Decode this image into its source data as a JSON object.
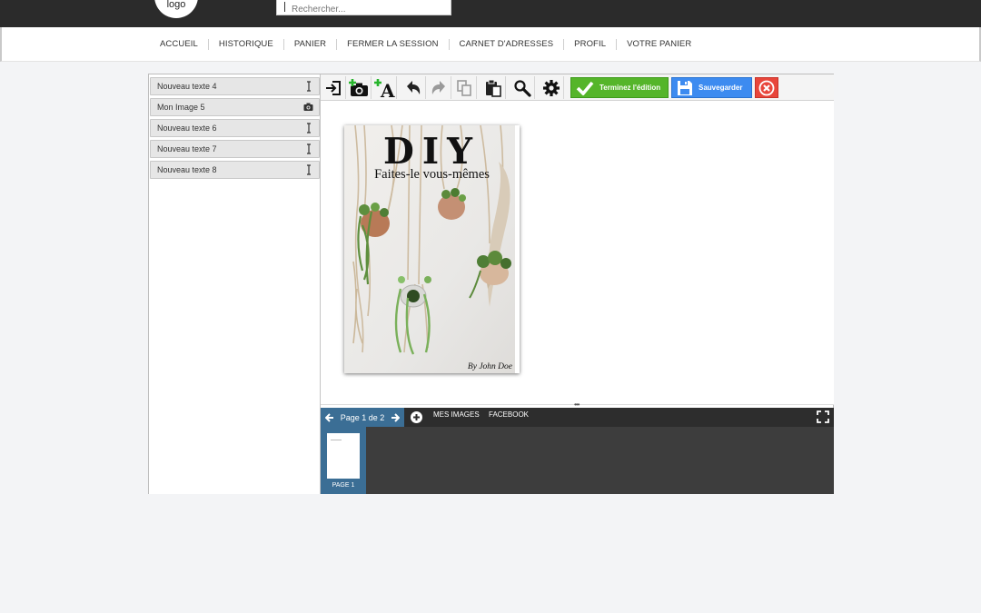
{
  "header": {
    "logo_text": "logo",
    "search_placeholder": "Rechercher..."
  },
  "nav": {
    "items": [
      "ACCUEIL",
      "HISTORIQUE",
      "PANIER",
      "FERMER LA SESSION",
      "CARNET D'ADRESSES",
      "PROFIL",
      "VOTRE PANIER"
    ]
  },
  "layers": [
    {
      "label": "Nouveau texte 4",
      "icon": "text-cursor-icon"
    },
    {
      "label": "Mon Image 5",
      "icon": "camera-icon"
    },
    {
      "label": "Nouveau texte 6",
      "icon": "text-cursor-icon"
    },
    {
      "label": "Nouveau texte 7",
      "icon": "text-cursor-icon"
    },
    {
      "label": "Nouveau texte 8",
      "icon": "text-cursor-icon"
    }
  ],
  "toolbar": {
    "finish_label": "Terminez l'édition",
    "save_label": "Sauvegarder",
    "icons": [
      "exit-icon",
      "add-image-icon",
      "add-text-icon",
      "undo-icon",
      "redo-icon",
      "copy-icon",
      "paste-icon",
      "zoom-icon",
      "settings-icon",
      "checkmark-icon",
      "floppy-disk-icon",
      "close-icon"
    ]
  },
  "cover": {
    "title": "DIY",
    "subtitle": "Faites-le vous-mêmes",
    "author": "By John Doe"
  },
  "pages": {
    "indicator": "Page 1 de 2",
    "tabs": [
      "MES IMAGES",
      "FACEBOOK"
    ],
    "thumb_label": "PAGE 1"
  },
  "colors": {
    "finish_button": "#55b52a",
    "save_button": "#3d8bf0",
    "close_button": "#e8463b",
    "page_tab": "#3b6e95",
    "header_bar": "#2b2b2b"
  }
}
